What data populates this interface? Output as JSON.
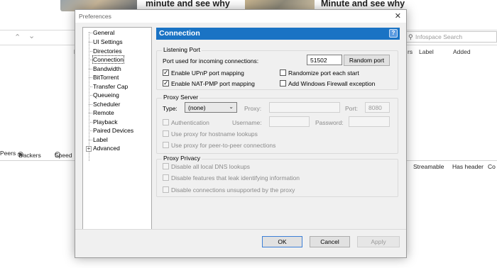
{
  "background": {
    "ad_texts": [
      "minute and see why",
      "Minute and see why"
    ],
    "search_placeholder": "Infospace Search",
    "column_headers": [
      "rs",
      "Label",
      "Added"
    ],
    "left_marker": "F",
    "detail_tabs": [
      "Peers",
      "Trackers",
      "Speed"
    ],
    "bottom_headers": [
      "Streamable",
      "Has header",
      "Co"
    ]
  },
  "dialog": {
    "title": "Preferences",
    "tree": {
      "items": [
        "General",
        "UI Settings",
        "Directories",
        "Connection",
        "Bandwidth",
        "BitTorrent",
        "Transfer Cap",
        "Queueing",
        "Scheduler",
        "Remote",
        "Playback",
        "Paired Devices",
        "Label",
        "Advanced"
      ],
      "selected": "Connection"
    },
    "header": {
      "title": "Connection",
      "help": "?"
    },
    "listening_port": {
      "title": "Listening Port",
      "port_label": "Port used for incoming connections:",
      "port_value": "51502",
      "random_button": "Random port",
      "upnp": "Enable UPnP port mapping",
      "natpmp": "Enable NAT-PMP port mapping",
      "randomize": "Randomize port each start",
      "firewall": "Add Windows Firewall exception"
    },
    "proxy_server": {
      "title": "Proxy Server",
      "type_label": "Type:",
      "type_value": "(none)",
      "proxy_label": "Proxy:",
      "port_label": "Port:",
      "port_value": "8080",
      "authentication": "Authentication",
      "username_label": "Username:",
      "password_label": "Password:",
      "hostname_lookups": "Use proxy for hostname lookups",
      "p2p": "Use proxy for peer-to-peer connections"
    },
    "proxy_privacy": {
      "title": "Proxy Privacy",
      "dns": "Disable all local DNS lookups",
      "leak": "Disable features that leak identifying information",
      "unsupported": "Disable connections unsupported by the proxy"
    },
    "buttons": {
      "ok": "OK",
      "cancel": "Cancel",
      "apply": "Apply"
    }
  }
}
